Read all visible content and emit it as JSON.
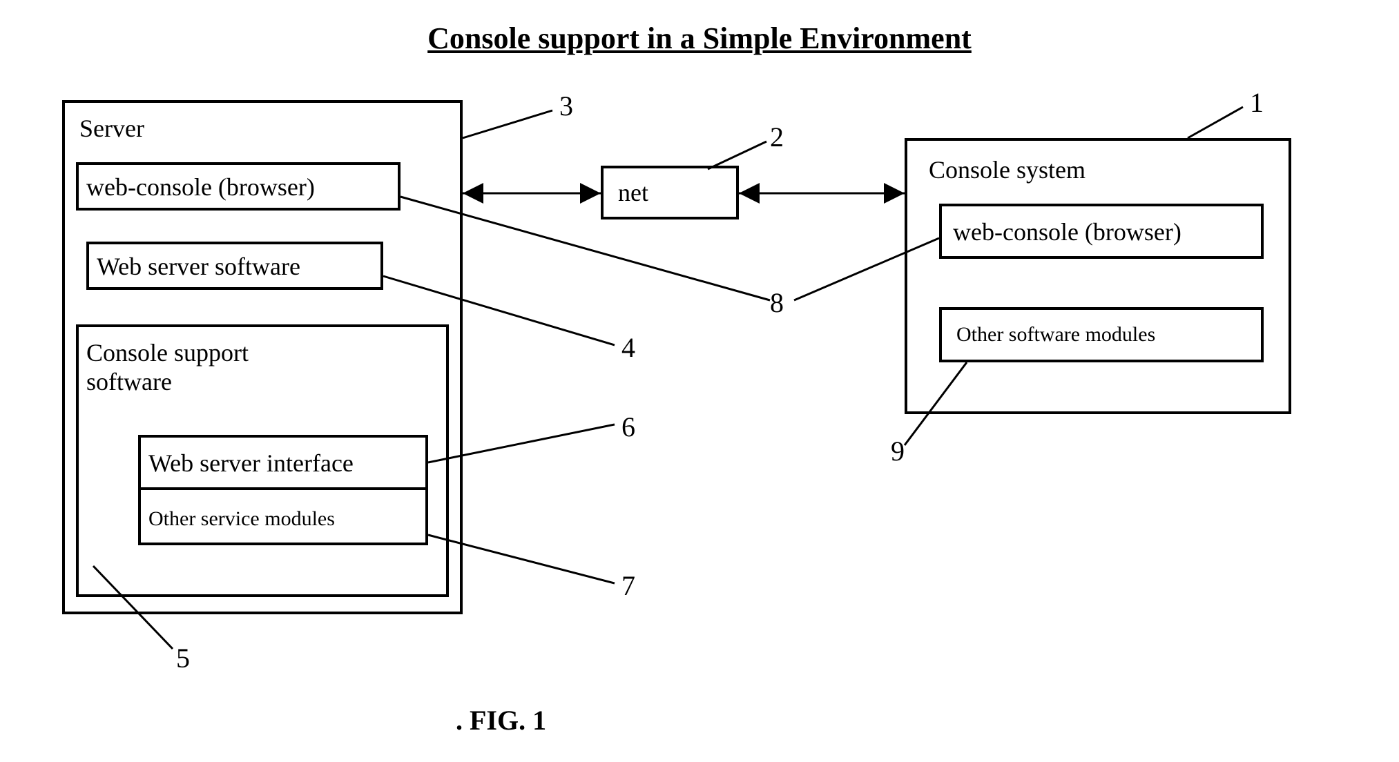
{
  "title": "Console support in a Simple Environment",
  "figure_caption": ". FIG. 1",
  "server": {
    "title": "Server",
    "web_console": "web-console (browser)",
    "web_server_software": "Web server software",
    "console_support_software": "Console support\nsoftware",
    "web_server_interface": "Web server interface",
    "other_service_modules": "Other service modules"
  },
  "net": "net",
  "console_system": {
    "title": "Console system",
    "web_console": "web-console (browser)",
    "other_modules": "Other software modules"
  },
  "numbers": {
    "n1": "1",
    "n2": "2",
    "n3": "3",
    "n4": "4",
    "n5": "5",
    "n6": "6",
    "n7": "7",
    "n8": "8",
    "n9": "9"
  }
}
